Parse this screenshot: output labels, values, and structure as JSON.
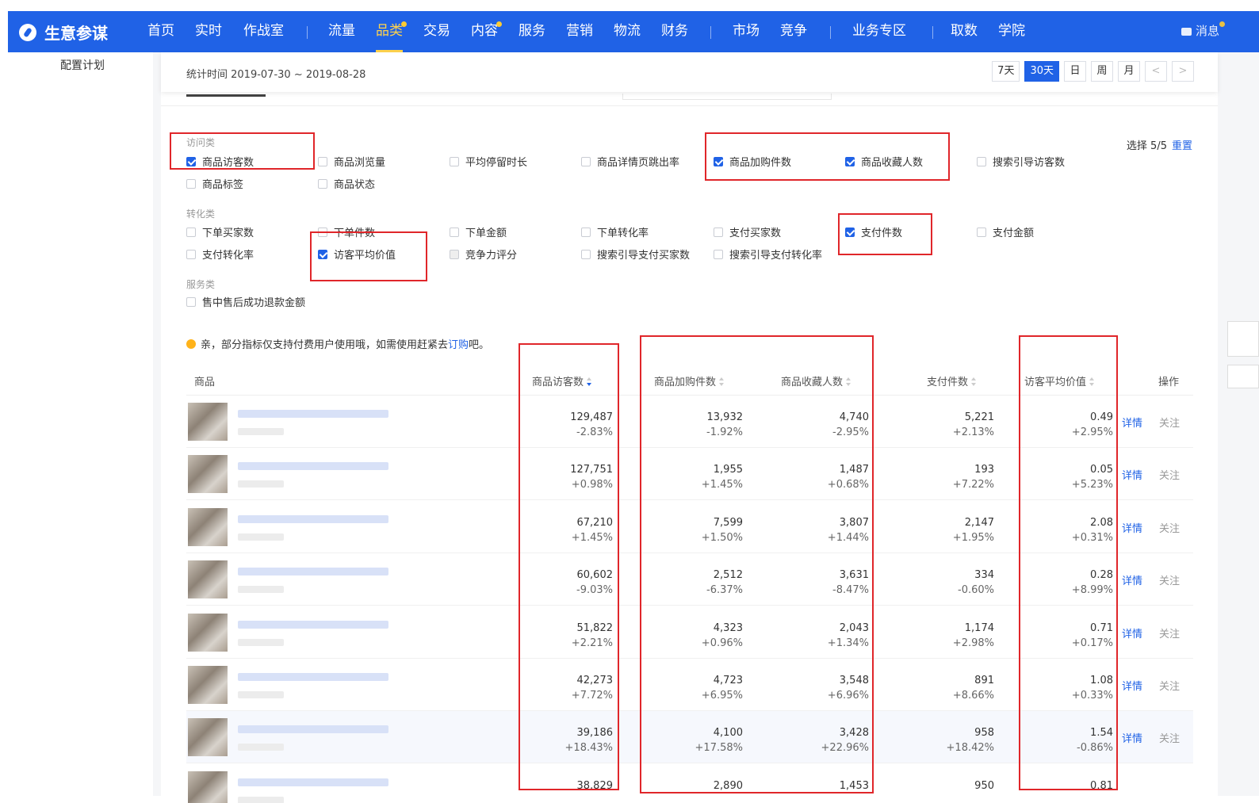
{
  "nav": {
    "brand": "生意参谋",
    "items": [
      {
        "label": "首页",
        "active": false,
        "dot": false
      },
      {
        "label": "实时",
        "active": false,
        "dot": false
      },
      {
        "label": "作战室",
        "active": false,
        "dot": false
      },
      {
        "label": "流量",
        "active": false,
        "dot": false
      },
      {
        "label": "品类",
        "active": true,
        "dot": true
      },
      {
        "label": "交易",
        "active": false,
        "dot": false
      },
      {
        "label": "内容",
        "active": false,
        "dot": true
      },
      {
        "label": "服务",
        "active": false,
        "dot": false
      },
      {
        "label": "营销",
        "active": false,
        "dot": false
      },
      {
        "label": "物流",
        "active": false,
        "dot": false
      },
      {
        "label": "财务",
        "active": false,
        "dot": false
      },
      {
        "label": "市场",
        "active": false,
        "dot": false
      },
      {
        "label": "竞争",
        "active": false,
        "dot": false
      },
      {
        "label": "业务专区",
        "active": false,
        "dot": false
      },
      {
        "label": "取数",
        "active": false,
        "dot": false
      },
      {
        "label": "学院",
        "active": false,
        "dot": false
      }
    ],
    "message": "消息"
  },
  "sidebar": {
    "item": "配置计划"
  },
  "stats": {
    "time_label": "统计时间 2019-07-30 ~ 2019-08-28",
    "ranges": [
      "7天",
      "30天",
      "日",
      "周",
      "月"
    ],
    "active_range": "30天",
    "prev": "<",
    "next": ">"
  },
  "metrics": {
    "selected_text": "选择 5/5",
    "reset": "重置",
    "groups": [
      {
        "title": "访问类",
        "options": [
          {
            "label": "商品访客数",
            "checked": true
          },
          {
            "label": "商品浏览量",
            "checked": false
          },
          {
            "label": "平均停留时长",
            "checked": false
          },
          {
            "label": "商品详情页跳出率",
            "checked": false
          },
          {
            "label": "商品加购件数",
            "checked": true
          },
          {
            "label": "商品收藏人数",
            "checked": true
          },
          {
            "label": "搜索引导访客数",
            "checked": false
          },
          {
            "label": "商品标签",
            "checked": false
          },
          {
            "label": "商品状态",
            "checked": false
          }
        ]
      },
      {
        "title": "转化类",
        "options": [
          {
            "label": "下单买家数",
            "checked": false
          },
          {
            "label": "下单件数",
            "checked": false
          },
          {
            "label": "下单金额",
            "checked": false
          },
          {
            "label": "下单转化率",
            "checked": false
          },
          {
            "label": "支付买家数",
            "checked": false
          },
          {
            "label": "支付件数",
            "checked": true
          },
          {
            "label": "支付金额",
            "checked": false
          },
          {
            "label": "支付转化率",
            "checked": false
          },
          {
            "label": "访客平均价值",
            "checked": true
          },
          {
            "label": "竞争力评分",
            "checked": false,
            "disabled": true
          },
          {
            "label": "搜索引导支付买家数",
            "checked": false
          },
          {
            "label": "搜索引导支付转化率",
            "checked": false
          }
        ]
      },
      {
        "title": "服务类",
        "options": [
          {
            "label": "售中售后成功退款金额",
            "checked": false
          }
        ]
      }
    ]
  },
  "notice": {
    "text": "亲，部分指标仅支持付费用户使用哦，如需使用赶紧去",
    "link": "订购",
    "suffix": "吧。"
  },
  "table": {
    "headers": {
      "product": "商品",
      "visitors": "商品访客数",
      "cart": "商品加购件数",
      "fav": "商品收藏人数",
      "paid": "支付件数",
      "avg_value": "访客平均价值",
      "action": "操作"
    },
    "action_detail": "详情",
    "action_follow": "关注",
    "rows": [
      {
        "visitors": "129,487",
        "visitors_chg": "-2.83%",
        "cart": "13,932",
        "cart_chg": "-1.92%",
        "fav": "4,740",
        "fav_chg": "-2.95%",
        "paid": "5,221",
        "paid_chg": "+2.13%",
        "avg": "0.49",
        "avg_chg": "+2.95%"
      },
      {
        "visitors": "127,751",
        "visitors_chg": "+0.98%",
        "cart": "1,955",
        "cart_chg": "+1.45%",
        "fav": "1,487",
        "fav_chg": "+0.68%",
        "paid": "193",
        "paid_chg": "+7.22%",
        "avg": "0.05",
        "avg_chg": "+5.23%"
      },
      {
        "visitors": "67,210",
        "visitors_chg": "+1.45%",
        "cart": "7,599",
        "cart_chg": "+1.50%",
        "fav": "3,807",
        "fav_chg": "+1.44%",
        "paid": "2,147",
        "paid_chg": "+1.95%",
        "avg": "2.08",
        "avg_chg": "+0.31%"
      },
      {
        "visitors": "60,602",
        "visitors_chg": "-9.03%",
        "cart": "2,512",
        "cart_chg": "-6.37%",
        "fav": "3,631",
        "fav_chg": "-8.47%",
        "paid": "334",
        "paid_chg": "-0.60%",
        "avg": "0.28",
        "avg_chg": "+8.99%"
      },
      {
        "visitors": "51,822",
        "visitors_chg": "+2.21%",
        "cart": "4,323",
        "cart_chg": "+0.96%",
        "fav": "2,043",
        "fav_chg": "+1.34%",
        "paid": "1,174",
        "paid_chg": "+2.98%",
        "avg": "0.71",
        "avg_chg": "+0.17%"
      },
      {
        "visitors": "42,273",
        "visitors_chg": "+7.72%",
        "cart": "4,723",
        "cart_chg": "+6.95%",
        "fav": "3,548",
        "fav_chg": "+6.96%",
        "paid": "891",
        "paid_chg": "+8.66%",
        "avg": "1.08",
        "avg_chg": "+0.33%"
      },
      {
        "visitors": "39,186",
        "visitors_chg": "+18.43%",
        "cart": "4,100",
        "cart_chg": "+17.58%",
        "fav": "3,428",
        "fav_chg": "+22.96%",
        "paid": "958",
        "paid_chg": "+18.42%",
        "avg": "1.54",
        "avg_chg": "-0.86%"
      },
      {
        "visitors": "38,829",
        "visitors_chg": "",
        "cart": "2,890",
        "cart_chg": "",
        "fav": "1,453",
        "fav_chg": "",
        "paid": "950",
        "paid_chg": "",
        "avg": "0.81",
        "avg_chg": ""
      }
    ]
  },
  "colors": {
    "brand": "#2062e6",
    "highlight": "#e0262a",
    "active_nav": "#ffd34d"
  }
}
